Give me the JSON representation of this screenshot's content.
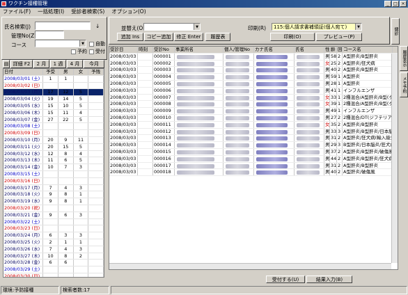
{
  "window": {
    "title": "ワクチン接種管理"
  },
  "menu": [
    "ファイル(F)",
    "一括処理(I)",
    "受診者検索(S)",
    "オプション(O)"
  ],
  "search": {
    "name_label": "氏名検索(J)",
    "name_value": "",
    "name_icon_text": "↓",
    "mgmt_label": "管理No(Z)",
    "mgmt_value": "",
    "course_label": "コース",
    "course_value": "",
    "auto_label": "自動",
    "reserve_label": "予約",
    "reception_label": "受付"
  },
  "calendar_tabs": [
    "詳細 F2",
    "2 月",
    "1 週",
    "4 月",
    "今月"
  ],
  "calendar": {
    "headers": [
      "日付",
      "予受",
      "男",
      "女",
      "予残"
    ],
    "rows": [
      {
        "date": "2008/03/01 (土)",
        "day": "sat",
        "a": "1",
        "b": "1",
        "c": "",
        "d": ""
      },
      {
        "date": "2008/03/02 (日)",
        "day": "sun",
        "a": "",
        "b": "",
        "c": "",
        "d": ""
      },
      {
        "date": "2008/03/03 (月)",
        "day": "wk",
        "a": "17",
        "b": "12",
        "c": "5",
        "d": ""
      },
      {
        "date": "2008/03/04 (火)",
        "day": "wk",
        "a": "19",
        "b": "14",
        "c": "5",
        "d": ""
      },
      {
        "date": "2008/03/05 (水)",
        "day": "wk",
        "a": "15",
        "b": "10",
        "c": "5",
        "d": ""
      },
      {
        "date": "2008/03/06 (木)",
        "day": "wk",
        "a": "15",
        "b": "11",
        "c": "4",
        "d": ""
      },
      {
        "date": "2008/03/07 (金)",
        "day": "wk",
        "a": "27",
        "b": "22",
        "c": "5",
        "d": ""
      },
      {
        "date": "2008/03/08 (土)",
        "day": "sat",
        "a": "",
        "b": "",
        "c": "",
        "d": ""
      },
      {
        "date": "2008/03/09 (日)",
        "day": "sun",
        "a": "",
        "b": "",
        "c": "",
        "d": ""
      },
      {
        "date": "2008/03/10 (月)",
        "day": "wk",
        "a": "20",
        "b": "9",
        "c": "11",
        "d": ""
      },
      {
        "date": "2008/03/11 (火)",
        "day": "wk",
        "a": "20",
        "b": "15",
        "c": "5",
        "d": ""
      },
      {
        "date": "2008/03/12 (水)",
        "day": "wk",
        "a": "12",
        "b": "8",
        "c": "4",
        "d": ""
      },
      {
        "date": "2008/03/13 (木)",
        "day": "wk",
        "a": "11",
        "b": "6",
        "c": "5",
        "d": ""
      },
      {
        "date": "2008/03/14 (金)",
        "day": "wk",
        "a": "10",
        "b": "7",
        "c": "3",
        "d": ""
      },
      {
        "date": "2008/03/15 (土)",
        "day": "sat",
        "a": "",
        "b": "",
        "c": "",
        "d": ""
      },
      {
        "date": "2008/03/16 (日)",
        "day": "sun",
        "a": "",
        "b": "",
        "c": "",
        "d": ""
      },
      {
        "date": "2008/03/17 (月)",
        "day": "wk",
        "a": "7",
        "b": "4",
        "c": "3",
        "d": ""
      },
      {
        "date": "2008/03/18 (火)",
        "day": "wk",
        "a": "9",
        "b": "8",
        "c": "1",
        "d": ""
      },
      {
        "date": "2008/03/19 (水)",
        "day": "wk",
        "a": "9",
        "b": "8",
        "c": "1",
        "d": ""
      },
      {
        "date": "2008/03/20 (祝)",
        "day": "sun",
        "a": "",
        "b": "",
        "c": "",
        "d": ""
      },
      {
        "date": "2008/03/21 (金)",
        "day": "wk",
        "a": "9",
        "b": "6",
        "c": "3",
        "d": ""
      },
      {
        "date": "2008/03/22 (土)",
        "day": "sat",
        "a": "",
        "b": "",
        "c": "",
        "d": ""
      },
      {
        "date": "2008/03/23 (日)",
        "day": "sun",
        "a": "",
        "b": "",
        "c": "",
        "d": ""
      },
      {
        "date": "2008/03/24 (月)",
        "day": "wk",
        "a": "6",
        "b": "3",
        "c": "3",
        "d": ""
      },
      {
        "date": "2008/03/25 (火)",
        "day": "wk",
        "a": "2",
        "b": "1",
        "c": "1",
        "d": ""
      },
      {
        "date": "2008/03/26 (水)",
        "day": "wk",
        "a": "7",
        "b": "4",
        "c": "3",
        "d": ""
      },
      {
        "date": "2008/03/27 (木)",
        "day": "wk",
        "a": "10",
        "b": "8",
        "c": "2",
        "d": ""
      },
      {
        "date": "2008/03/28 (金)",
        "day": "wk",
        "a": "6",
        "b": "6",
        "c": "",
        "d": ""
      },
      {
        "date": "2008/03/29 (土)",
        "day": "sat",
        "a": "",
        "b": "",
        "c": "",
        "d": ""
      },
      {
        "date": "2008/03/30 (日)",
        "day": "sun",
        "a": "",
        "b": "",
        "c": "",
        "d": ""
      },
      {
        "date": "2008/03/31 (月)",
        "day": "wk",
        "a": "4",
        "b": "4",
        "c": "",
        "d": ""
      }
    ]
  },
  "toolbar": {
    "sort_label": "並替え(O)",
    "sort_value": "",
    "print_label": "印刷(R)",
    "print_value": "115:個人請求書補領証(個人宛て)",
    "add_label": "追加 Ins",
    "copy_label": "コピー追加",
    "edit_label": "修正 Enter",
    "history_label": "履歴表",
    "print_button": "印刷(O)",
    "preview_button": "プレビュー(P)"
  },
  "list": {
    "headers": [
      "受診日",
      "時刻",
      "受診No",
      "事業所名",
      "個人/管理No",
      "カナ氏名",
      "氏名",
      "性",
      "齢",
      "回",
      "コース名"
    ],
    "rows": [
      {
        "date": "2008/03/03",
        "no": "000001",
        "sex": "男",
        "age": "58",
        "n": "2",
        "course": "A型肝炎/B型肝炎"
      },
      {
        "date": "2008/03/03",
        "no": "000002",
        "sex": "女",
        "age": "25",
        "n": "2",
        "course": "A型肝炎/狂犬病"
      },
      {
        "date": "2008/03/03",
        "no": "000003",
        "sex": "男",
        "age": "40",
        "n": "2",
        "course": "A型肝炎/B型肝炎"
      },
      {
        "date": "2008/03/03",
        "no": "000004",
        "sex": "男",
        "age": "59",
        "n": "1",
        "course": "A型肝炎"
      },
      {
        "date": "2008/03/03",
        "no": "000005",
        "sex": "男",
        "age": "28",
        "n": "1",
        "course": "A型肝炎"
      },
      {
        "date": "2008/03/03",
        "no": "000006",
        "sex": "男",
        "age": "41",
        "n": "1",
        "course": "インフルエンザ"
      },
      {
        "date": "2008/03/03",
        "no": "000007",
        "sex": "女",
        "age": "33",
        "n": "1",
        "course": "2種混合/A型肝炎/B型(ダイ"
      },
      {
        "date": "2008/03/03",
        "no": "000008",
        "sex": "女",
        "age": "39",
        "n": "1",
        "course": "2種混合/A型肝炎/B型(ダイ"
      },
      {
        "date": "2008/03/03",
        "no": "000009",
        "sex": "男",
        "age": "49",
        "n": "1",
        "course": "インフルエンザ"
      },
      {
        "date": "2008/03/03",
        "no": "000010",
        "sex": "男",
        "age": "27",
        "n": "2",
        "course": "2種混合/DT(ジフテリア・"
      },
      {
        "date": "2008/03/03",
        "no": "000011",
        "sex": "女",
        "age": "35",
        "n": "2",
        "course": "A型肝炎/B型肝炎"
      },
      {
        "date": "2008/03/03",
        "no": "000012",
        "sex": "男",
        "age": "33",
        "n": "3",
        "course": "A型肝炎/B型肝炎/日本脳"
      },
      {
        "date": "2008/03/03",
        "no": "000013",
        "sex": "男",
        "age": "31",
        "n": "2",
        "course": "A型肝炎/狂犬病(輸入級生)"
      },
      {
        "date": "2008/03/03",
        "no": "000014",
        "sex": "男",
        "age": "29",
        "n": "3",
        "course": "B型肝炎/日本脳炎/狂犬病"
      },
      {
        "date": "2008/03/03",
        "no": "000015",
        "sex": "男",
        "age": "37",
        "n": "2",
        "course": "A型肝炎/B型肝炎/破傷風"
      },
      {
        "date": "2008/03/03",
        "no": "000016",
        "sex": "男",
        "age": "44",
        "n": "2",
        "course": "A型肝炎/B型肝炎/狂犬病"
      },
      {
        "date": "2008/03/03",
        "no": "000017",
        "sex": "男",
        "age": "31",
        "n": "2",
        "course": "A型肝炎/B型肝炎"
      },
      {
        "date": "2008/03/03",
        "no": "000018",
        "sex": "男",
        "age": "40",
        "n": "2",
        "course": "A型肝炎/破傷風"
      }
    ]
  },
  "bottom_buttons": {
    "receive": "受付する(U)",
    "result": "結果入力(B)"
  },
  "side_tabs": [
    "健診",
    "履歴表示",
    "メモ予約"
  ],
  "status": {
    "env": "環境:予防接種",
    "count": "検索者数:17"
  },
  "colors": {
    "accent": "#0a246a",
    "sunday": "#d00000",
    "saturday": "#0000c8"
  }
}
